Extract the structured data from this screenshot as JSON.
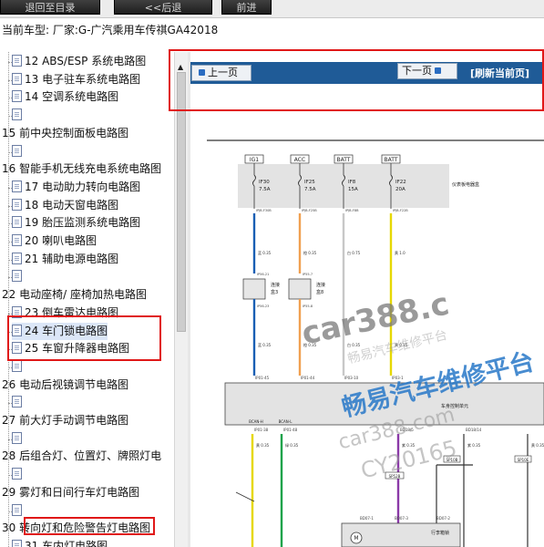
{
  "toolbar": {
    "buttons": [
      {
        "label": "退回至目录"
      },
      {
        "label": "<<后退"
      },
      {
        "label": "前进"
      }
    ]
  },
  "current_model": "当前车型:  厂家:G-广汽乘用车传祺GA42018",
  "tree": {
    "items": [
      {
        "label": "12 ABS/ESP 系统电路图",
        "child": true
      },
      {
        "label": "13 电子驻车系统电路图",
        "child": true
      },
      {
        "label": "14 空调系统电路图",
        "child": true
      },
      {
        "label": "",
        "child": true
      },
      {
        "label": "15 前中央控制面板电路图",
        "child": false
      },
      {
        "label": "",
        "child": true
      },
      {
        "label": "16 智能手机无线充电系统电路图",
        "child": false
      },
      {
        "label": "17 电动助力转向电路图",
        "child": true
      },
      {
        "label": "18 电动天窗电路图",
        "child": true
      },
      {
        "label": "19 胎压监测系统电路图",
        "child": true
      },
      {
        "label": "20 喇叭电路图",
        "child": true
      },
      {
        "label": "21 辅助电源电路图",
        "child": true
      },
      {
        "label": "",
        "child": true
      },
      {
        "label": "22 电动座椅/ 座椅加热电路图",
        "child": false
      },
      {
        "label": "23 倒车雷达电路图",
        "child": true
      },
      {
        "label": "24 车门锁电路图",
        "child": true,
        "selected": true
      },
      {
        "label": "25 车窗升降器电路图",
        "child": true
      },
      {
        "label": "",
        "child": true
      },
      {
        "label": "26 电动后视镜调节电路图",
        "child": false
      },
      {
        "label": "",
        "child": true
      },
      {
        "label": "27 前大灯手动调节电路图",
        "child": false
      },
      {
        "label": "",
        "child": true
      },
      {
        "label": "28 后组合灯、位置灯、牌照灯电",
        "child": false
      },
      {
        "label": "",
        "child": true
      },
      {
        "label": "29 雾灯和日间行车灯电路图",
        "child": false
      },
      {
        "label": "",
        "child": true
      },
      {
        "label": "30 转向灯和危险警告灯电路图",
        "child": false
      },
      {
        "label": "31 车内灯电路图",
        "child": true
      },
      {
        "label": "32 雨刮及清洗电路图",
        "child": true
      }
    ]
  },
  "pager": {
    "prev_label": "上一页",
    "next_label": "下一页",
    "refresh_label": "[刷新当前页]"
  },
  "diagram": {
    "top_labels": [
      "IG1",
      "ACC",
      "BATT",
      "BATT"
    ],
    "fuses": [
      {
        "name": "IF30",
        "rating": "7.5A"
      },
      {
        "name": "IF25",
        "rating": "7.5A"
      },
      {
        "name": "IF8",
        "rating": "15A"
      },
      {
        "name": "IF22",
        "rating": "20A"
      }
    ],
    "fuse_box_label": "仪表板电器盒",
    "fuse_pins": [
      "IPJB-F30B",
      "IPJB-F25B",
      "IPJB-F8B",
      "IPJB-F22B"
    ],
    "wire_labels": [
      "蓝 0.35",
      "橙 0.35",
      "白 0.75",
      "黄 1.0"
    ],
    "connector_pins_top": [
      "IP56-21",
      "IP55-7"
    ],
    "connector_labels": [
      "连接盒3",
      "连接盒8"
    ],
    "connector_pins_bottom": [
      "IP56-23",
      "IP55-8"
    ],
    "wire_labels_2": [
      "蓝 0.35",
      "橙 0.35",
      "白 0.35",
      "黄 0.35"
    ],
    "module_pins_top": [
      "IP01-45",
      "IP01-44",
      "IP03-10",
      "IP03-1"
    ],
    "module_label": "车身控制单元",
    "bcan_labels": [
      "BCAN-H",
      "BCAN-L"
    ],
    "module_pins_bottom": [
      "IP01-38",
      "IP01-48",
      "BD18/5",
      "BD18/14"
    ],
    "wire_labels_3": [
      "黄 0.35",
      "绿 0.35",
      "紫 0.35",
      "紫 0.35",
      "黄 0.35"
    ],
    "splices": [
      "SP10B",
      "SP52B",
      "SP10E"
    ],
    "lower_pins": [
      "BD07-1",
      "BD07-3",
      "BD07-2"
    ],
    "lower_component_label": "行李箱锁",
    "motor_label": "M"
  },
  "watermarks": [
    "car388.c",
    "畅易汽车维修平台",
    "car388.com",
    "CY20165",
    "畅易汽车维修平台"
  ],
  "colors": {
    "nav_bar": "#1f5b97",
    "highlight": "#e01818",
    "wire_blue": "#1a5fb4",
    "wire_orange": "#f0a050",
    "wire_yellow": "#e6d800",
    "wire_green": "#17a34a",
    "wire_purple": "#8b3aa8"
  }
}
